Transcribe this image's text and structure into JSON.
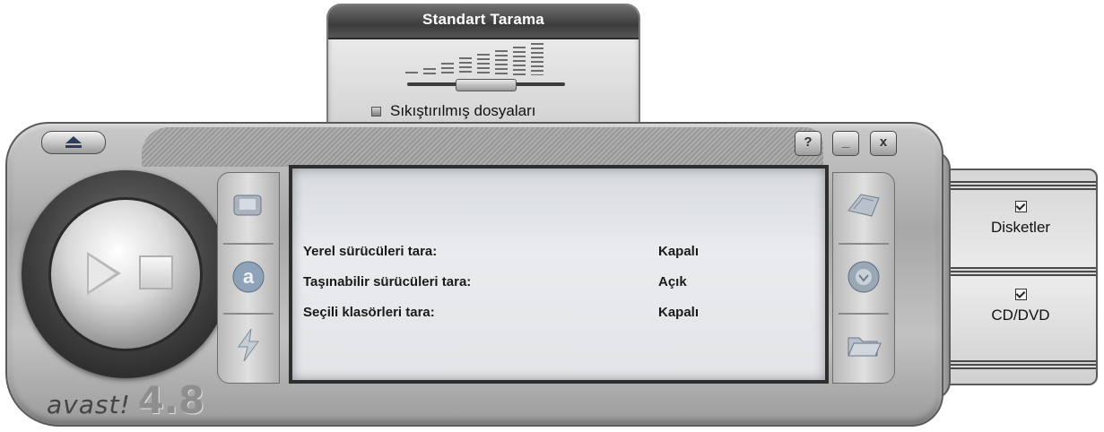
{
  "scan_panel": {
    "title": "Standart Tarama",
    "compressed_files_label": "Sıkıştırılmış dosyaları"
  },
  "window_controls": {
    "help_label": "?",
    "minimize_label": "_",
    "close_label": "x"
  },
  "branding": {
    "logo_text": "avast!",
    "version": "4.8"
  },
  "screen": {
    "rows": [
      {
        "label": "Yerel sürücüleri tara:",
        "value": "Kapalı"
      },
      {
        "label": "Taşınabilir sürücüleri tara:",
        "value": "Açık"
      },
      {
        "label": "Seçili klasörleri tara:",
        "value": "Kapalı"
      }
    ]
  },
  "drawer": {
    "options": [
      {
        "label": "Disketler",
        "checked": true
      },
      {
        "label": "CD/DVD",
        "checked": true
      }
    ]
  },
  "icons": {
    "left_column": [
      "scan-provider-icon",
      "avast-a-icon",
      "lightning-icon"
    ],
    "right_column": [
      "disk-scan-icon",
      "resident-shield-icon",
      "folder-icon"
    ]
  }
}
